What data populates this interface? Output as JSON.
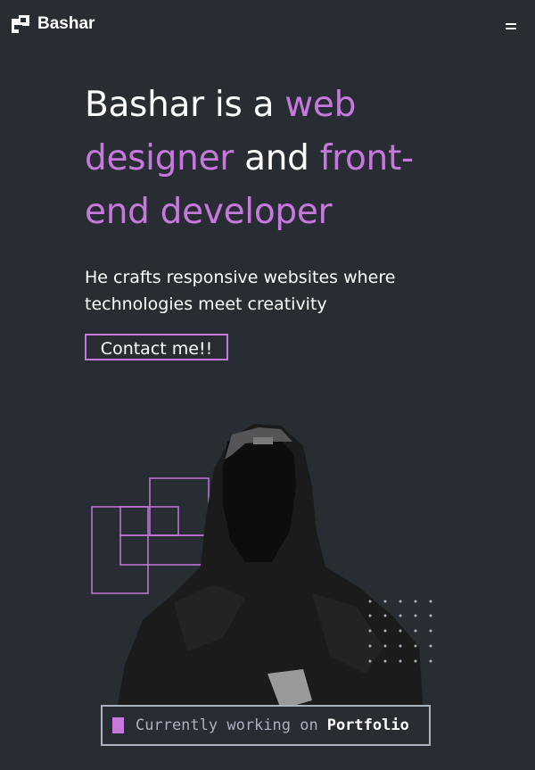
{
  "brand": {
    "name": "Bashar",
    "logo_icon": "logo-glyph-icon"
  },
  "nav": {
    "menu_icon": "hamburger-icon"
  },
  "hero": {
    "headline_parts": {
      "p1": "Bashar is a ",
      "p2": "web designer",
      "p3": " and ",
      "p4": "front-end developer"
    },
    "subtitle": "He crafts responsive websites where technologies meet creativity",
    "cta_label": "Contact me!!",
    "image_icon": "hooded-person-photo"
  },
  "status": {
    "prefix": "Currently working on",
    "project": "Portfolio"
  },
  "colors": {
    "background": "#282c33",
    "accent": "#c778dd",
    "text": "#ffffff",
    "muted": "#abb2bf"
  }
}
